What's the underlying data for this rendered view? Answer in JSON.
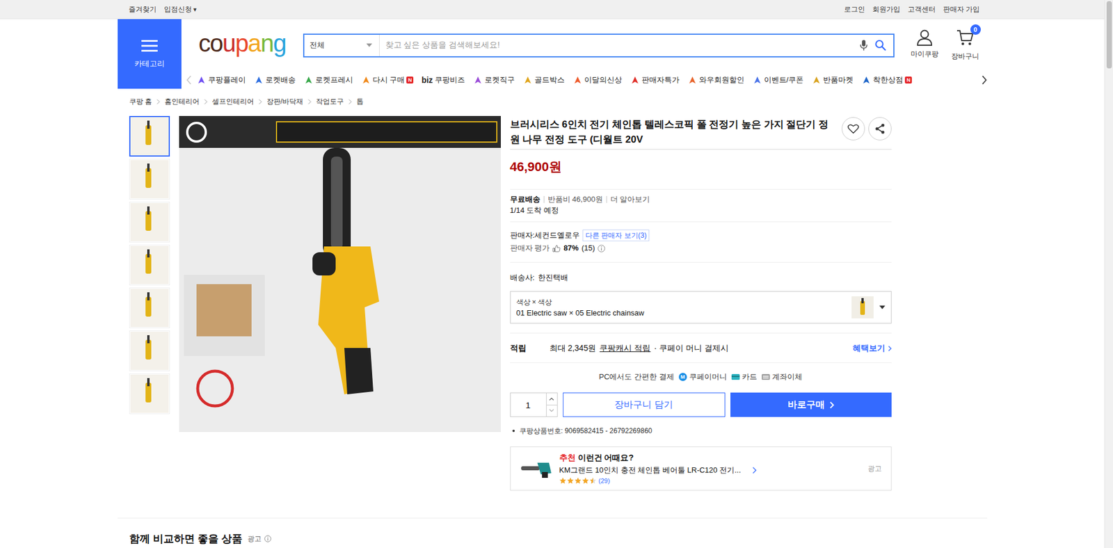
{
  "topbar": {
    "left": [
      {
        "label": "즐겨찾기",
        "caret": ""
      },
      {
        "label": "입점신청",
        "caret": "▾"
      }
    ],
    "right": [
      "로그인",
      "회원가입",
      "고객센터",
      "판매자 가입"
    ]
  },
  "header": {
    "category_label": "카테고리",
    "logo": "coupang",
    "search": {
      "scope": "전체",
      "placeholder": "찾고 싶은 상품을 검색해보세요!"
    },
    "my_label": "마이쿠팡",
    "cart_label": "장바구니",
    "cart_badge": "0"
  },
  "nav": {
    "prev": {
      "disabled": true
    },
    "next": {
      "disabled": false
    },
    "items": [
      {
        "label": "쿠팡플레이",
        "kind": "icon",
        "color": "#6f4ff2",
        "badge": ""
      },
      {
        "label": "로켓배송",
        "kind": "icon",
        "color": "#2f6fe0",
        "badge": ""
      },
      {
        "label": "로켓프레시",
        "kind": "icon",
        "color": "#38a84a",
        "badge": ""
      },
      {
        "label": "다시 구매",
        "kind": "icon",
        "color": "#f08a1c",
        "badge": "N"
      },
      {
        "label": "쿠팡비즈",
        "kind": "text-logo",
        "prefix": "biz",
        "color": "#222222",
        "badge": ""
      },
      {
        "label": "로켓직구",
        "kind": "icon",
        "color": "#9b4dd8",
        "badge": ""
      },
      {
        "label": "골드박스",
        "kind": "icon",
        "color": "#e0a51c",
        "badge": ""
      },
      {
        "label": "이달의신상",
        "kind": "icon",
        "color": "#ee5a2a",
        "badge": ""
      },
      {
        "label": "판매자특가",
        "kind": "icon",
        "color": "#e0302a",
        "badge": ""
      },
      {
        "label": "와우회원할인",
        "kind": "icon",
        "color": "#e8642c",
        "badge": ""
      },
      {
        "label": "이벤트/쿠폰",
        "kind": "icon",
        "color": "#4a73e8",
        "badge": ""
      },
      {
        "label": "반품마켓",
        "kind": "icon",
        "color": "#d9a320",
        "badge": ""
      },
      {
        "label": "착한상점",
        "kind": "icon",
        "color": "#1f66c9",
        "badge": "N"
      }
    ]
  },
  "breadcrumb": [
    "쿠팡 홈",
    "홈인테리어",
    "셀프인테리어",
    "장판/바닥재",
    "작업도구",
    "톱"
  ],
  "product": {
    "thumbnails": [
      {
        "selected": true
      },
      {
        "selected": false
      },
      {
        "selected": false
      },
      {
        "selected": false
      },
      {
        "selected": false
      },
      {
        "selected": false
      },
      {
        "selected": false
      }
    ],
    "title": "브러시리스 6인치 전기 체인톱 텔레스코픽 폴 전정기 높은 가지 절단기 정원 나무 전정 도구 (디월트 20V",
    "price": "46,900원",
    "shipping": {
      "free": "무료배송",
      "return_fee": "반품비 46,900원",
      "more": "더 알아보기",
      "arrival": "1/14 도착 예정"
    },
    "seller": {
      "label": "판매자:",
      "name": "세컨드옐로우",
      "others": "다른 판매자 보기(3)",
      "rating_label": "판매자 평가",
      "rating": "87%",
      "count": "(15)"
    },
    "carrier": {
      "label": "배송사:",
      "name": "한진택배"
    },
    "option": {
      "label": "색상 × 색상",
      "value": "01 Electric saw × 05 Electric chainsaw"
    },
    "reward": {
      "label": "적립",
      "amount": "최대 2,345원",
      "link": "쿠팡캐시 적립",
      "note": "· 쿠페이 머니 결제시",
      "benefit": "혜택보기"
    },
    "payment": {
      "label": "PC에서도 간편한 결제",
      "methods": [
        {
          "label": "쿠페이머니",
          "kind": "coupay",
          "icon": "M"
        },
        {
          "label": "카드",
          "kind": "card",
          "icon": ""
        },
        {
          "label": "계좌이체",
          "kind": "bank",
          "icon": ""
        }
      ]
    },
    "purchase": {
      "quantity": "1",
      "cart_button": "장바구니 담기",
      "buy_button": "바로구매"
    },
    "product_number": "쿠팡상품번호: 9069582415 - 26792269860",
    "recommendation": {
      "tag": "추천",
      "title": "이런건 어때요?",
      "name": "KM그랜드 10인치 충전 체인톱 베어툴 LR-C120 전기...",
      "stars": 4.5,
      "reviews": "(29)",
      "ad": "광고"
    }
  },
  "compare": {
    "title": "함께 비교하면 좋을 상품",
    "ad": "광고"
  }
}
